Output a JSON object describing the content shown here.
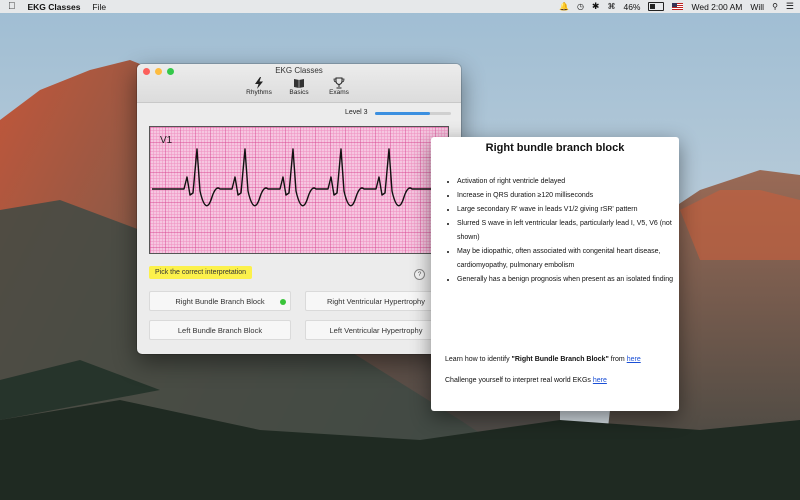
{
  "menubar": {
    "app_name": "EKG Classes",
    "menus": [
      "File"
    ],
    "battery": "46%",
    "clock": "Wed 2:00 AM",
    "user": "Will"
  },
  "window": {
    "title": "EKG Classes",
    "toolbar": [
      {
        "label": "Rhythms",
        "icon": "lightning-icon"
      },
      {
        "label": "Basics",
        "icon": "book-icon"
      },
      {
        "label": "Exams",
        "icon": "trophy-icon"
      }
    ],
    "level_label": "Level 3",
    "level_progress": 0.72,
    "lead": "V1",
    "prompt": "Pick the correct interpretation",
    "help": "?",
    "answers": [
      "Right Bundle Branch Block",
      "Right Ventricular Hypertrophy",
      "Left Bundle Branch Block",
      "Left Ventricular Hypertrophy"
    ]
  },
  "panel": {
    "title": "Right bundle branch block",
    "bullets": [
      "Activation of right ventricle delayed",
      "Increase in QRS duration ≥120 milliseconds",
      "Large secondary R' wave in leads V1/2 giving rSR' pattern",
      "Slurred S wave in left ventricular leads, particularly lead I, V5, V6 (not shown)",
      "May be idiopathic, often associated with congenital heart disease, cardiomyopathy, pulmonary embolism",
      "Generally has a benign prognosis when present as an isolated finding"
    ],
    "learn_prefix": "Learn how to identify ",
    "learn_bold": "\"Right Bundle Branch Block\"",
    "learn_mid": " from ",
    "learn_link": "here",
    "challenge_prefix": "Challenge yourself to interpret real world EKGs ",
    "challenge_link": "here"
  }
}
